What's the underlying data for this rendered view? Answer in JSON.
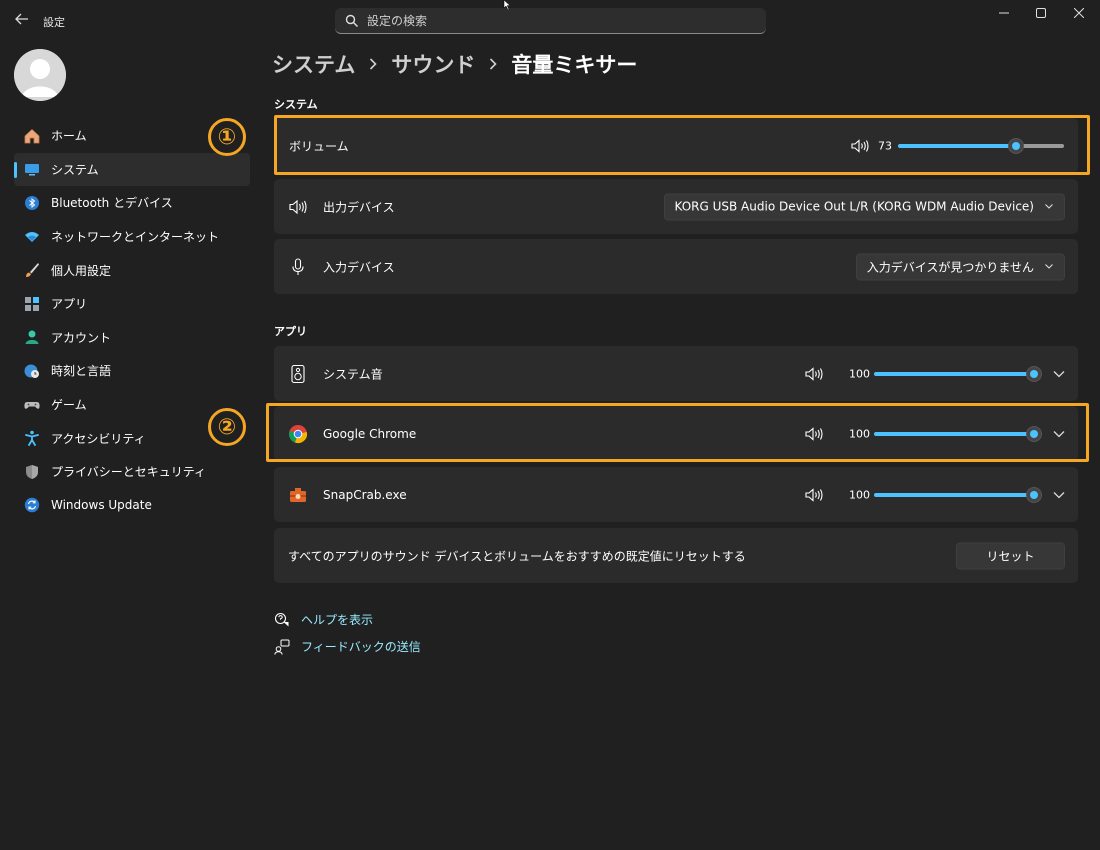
{
  "window": {
    "title": "設定",
    "back_icon": "back-arrow-icon",
    "search_placeholder": "設定の検索",
    "controls": [
      "minimize-icon",
      "maximize-icon",
      "close-icon"
    ]
  },
  "sidebar": {
    "items": [
      {
        "label": "ホーム",
        "icon": "home-icon",
        "selected": false
      },
      {
        "label": "システム",
        "icon": "monitor-icon",
        "selected": true
      },
      {
        "label": "Bluetooth とデバイス",
        "icon": "bluetooth-icon",
        "selected": false
      },
      {
        "label": "ネットワークとインターネット",
        "icon": "wifi-icon",
        "selected": false
      },
      {
        "label": "個人用設定",
        "icon": "brush-icon",
        "selected": false
      },
      {
        "label": "アプリ",
        "icon": "apps-icon",
        "selected": false
      },
      {
        "label": "アカウント",
        "icon": "person-icon",
        "selected": false
      },
      {
        "label": "時刻と言語",
        "icon": "globe-clock-icon",
        "selected": false
      },
      {
        "label": "ゲーム",
        "icon": "gamepad-icon",
        "selected": false
      },
      {
        "label": "アクセシビリティ",
        "icon": "accessibility-icon",
        "selected": false
      },
      {
        "label": "プライバシーとセキュリティ",
        "icon": "shield-icon",
        "selected": false
      },
      {
        "label": "Windows Update",
        "icon": "update-icon",
        "selected": false
      }
    ]
  },
  "breadcrumb": {
    "items": [
      "システム",
      "サウンド"
    ],
    "current": "音量ミキサー"
  },
  "system_section": {
    "title": "システム",
    "volume": {
      "label": "ボリューム",
      "value": "73",
      "level": 73
    },
    "output": {
      "label": "出力デバイス",
      "value": "KORG USB Audio Device Out L/R (KORG WDM Audio Device)"
    },
    "input": {
      "label": "入力デバイス",
      "value": "入力デバイスが見つかりません"
    }
  },
  "apps_section": {
    "title": "アプリ",
    "apps": [
      {
        "name": "システム音",
        "volume": "100",
        "level": 100,
        "icon": "speaker-device-icon"
      },
      {
        "name": "Google Chrome",
        "volume": "100",
        "level": 100,
        "icon": "chrome-icon"
      },
      {
        "name": "SnapCrab.exe",
        "volume": "100",
        "level": 100,
        "icon": "snapcrab-icon"
      }
    ],
    "reset": {
      "label": "すべてのアプリのサウンド デバイスとボリュームをおすすめの既定値にリセットする",
      "button": "リセット"
    }
  },
  "annotations": {
    "first": "①",
    "second": "②",
    "color": "#f5a623"
  },
  "links": {
    "help": "ヘルプを表示",
    "feedback": "フィードバックの送信"
  },
  "colors": {
    "accent": "#4cc2ff",
    "background": "#202020",
    "card": "#2b2b2b",
    "link": "#99ebff"
  }
}
